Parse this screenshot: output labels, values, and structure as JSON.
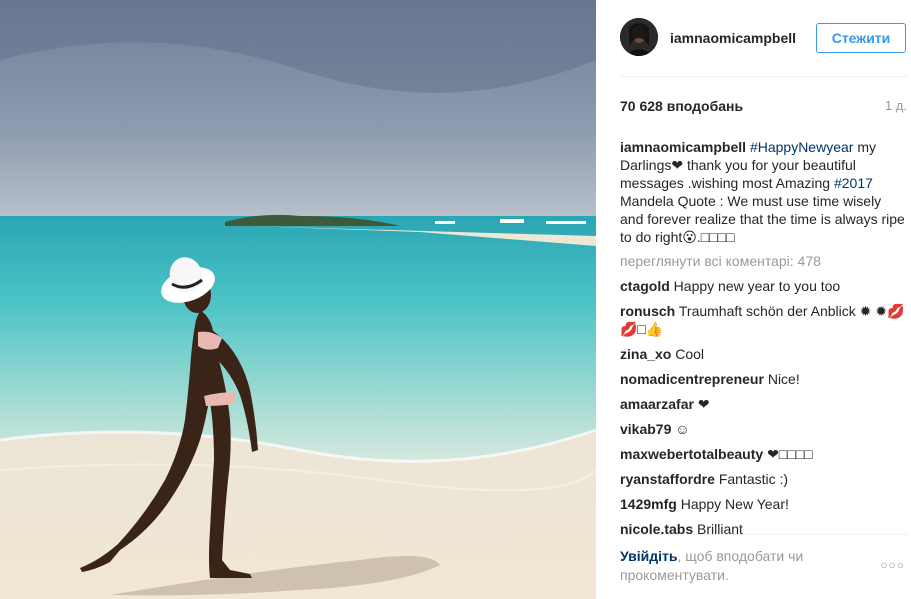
{
  "post": {
    "username": "iamnaomicampbell",
    "follow_label": "Стежити",
    "likes": "70 628 вподобань",
    "time_ago": "1 д."
  },
  "caption": {
    "username": "iamnaomicampbell",
    "hashtag1": "#HappyNewyear",
    "text1": " my Darlings❤ thank you for your beautiful messages .wishing most Amazing ",
    "hashtag2": "#2017",
    "text2": " Mandela Quote : We must use time wisely and forever realize that the time is always ripe to do right😮.□□□□"
  },
  "view_all_comments": "переглянути всі коментарі: 478",
  "comments": [
    {
      "user": "ctagold",
      "text": "Happy new year to you too"
    },
    {
      "user": "ronusch",
      "text": "Traumhaft schön der Anblick ✹ ✹💋💋□👍"
    },
    {
      "user": "zina_xo",
      "text": "Cool"
    },
    {
      "user": "nomadicentrepreneur",
      "text": "Nice!"
    },
    {
      "user": "amaarzafar",
      "text": "❤"
    },
    {
      "user": "vikab79",
      "text": "☺"
    },
    {
      "user": "maxwebertotalbeauty",
      "text": "❤□□□□"
    },
    {
      "user": "ryanstaffordre",
      "text": "Fantastic :)"
    },
    {
      "user": "1429mfg",
      "text": "Happy New Year!"
    },
    {
      "user": "nicole.tabs",
      "text": "Brilliant"
    }
  ],
  "footer": {
    "login_link": "Увійдіть",
    "login_rest": ", щоб вподобати чи прокоментувати.",
    "more_label": "○○○"
  },
  "icons": {
    "avatar": "profile-photo",
    "more": "more-options-icon"
  },
  "colors": {
    "accent": "#3897f0",
    "link": "#003569",
    "muted": "#999999"
  }
}
